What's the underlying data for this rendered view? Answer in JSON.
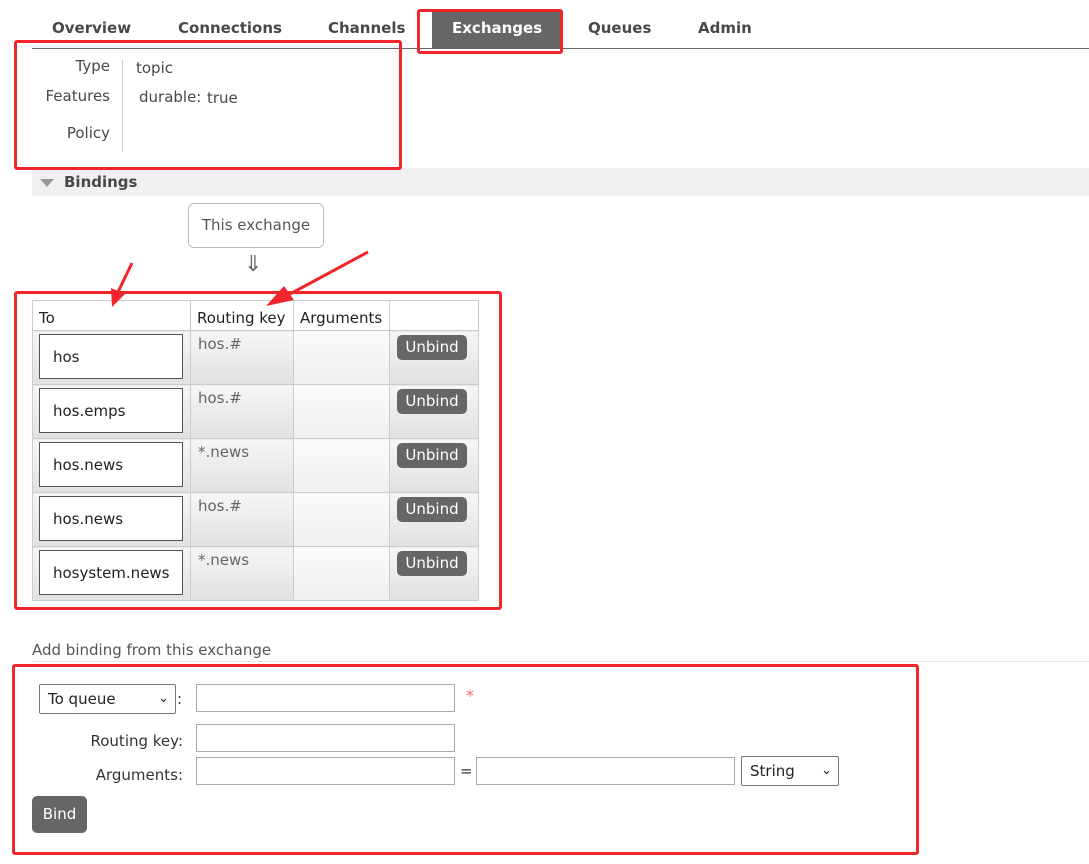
{
  "nav": {
    "tabs": [
      {
        "label": "Overview"
      },
      {
        "label": "Connections"
      },
      {
        "label": "Channels"
      },
      {
        "label": "Exchanges"
      },
      {
        "label": "Queues"
      },
      {
        "label": "Admin"
      }
    ],
    "active_tab": "Exchanges"
  },
  "details": {
    "type_label": "Type",
    "type_value": "topic",
    "features_label": "Features",
    "feature_key": "durable:",
    "feature_value": "true",
    "policy_label": "Policy"
  },
  "bindings": {
    "section_title": "Bindings",
    "source_box": "This exchange",
    "arrow_glyph": "⇓",
    "columns": [
      "To",
      "Routing key",
      "Arguments",
      ""
    ],
    "rows": [
      {
        "to": "hos",
        "routing_key": "hos.#",
        "arguments": "",
        "action": "Unbind"
      },
      {
        "to": "hos.emps",
        "routing_key": "hos.#",
        "arguments": "",
        "action": "Unbind"
      },
      {
        "to": "hos.news",
        "routing_key": "*.news",
        "arguments": "",
        "action": "Unbind"
      },
      {
        "to": "hos.news",
        "routing_key": "hos.#",
        "arguments": "",
        "action": "Unbind"
      },
      {
        "to": "hosystem.news",
        "routing_key": "*.news",
        "arguments": "",
        "action": "Unbind"
      }
    ]
  },
  "add_binding": {
    "title": "Add binding from this exchange",
    "destination_type": "To queue",
    "colon": ":",
    "required_mark": "*",
    "destination_value": "",
    "routing_key_label": "Routing key:",
    "routing_key_value": "",
    "arguments_label": "Arguments:",
    "argument_key_value": "",
    "equals": "=",
    "argument_value": "",
    "argument_type": "String",
    "bind_button": "Bind"
  },
  "colors": {
    "annotation_red": "#f0262a",
    "tab_active_bg": "#666666",
    "button_bg": "#666666"
  }
}
